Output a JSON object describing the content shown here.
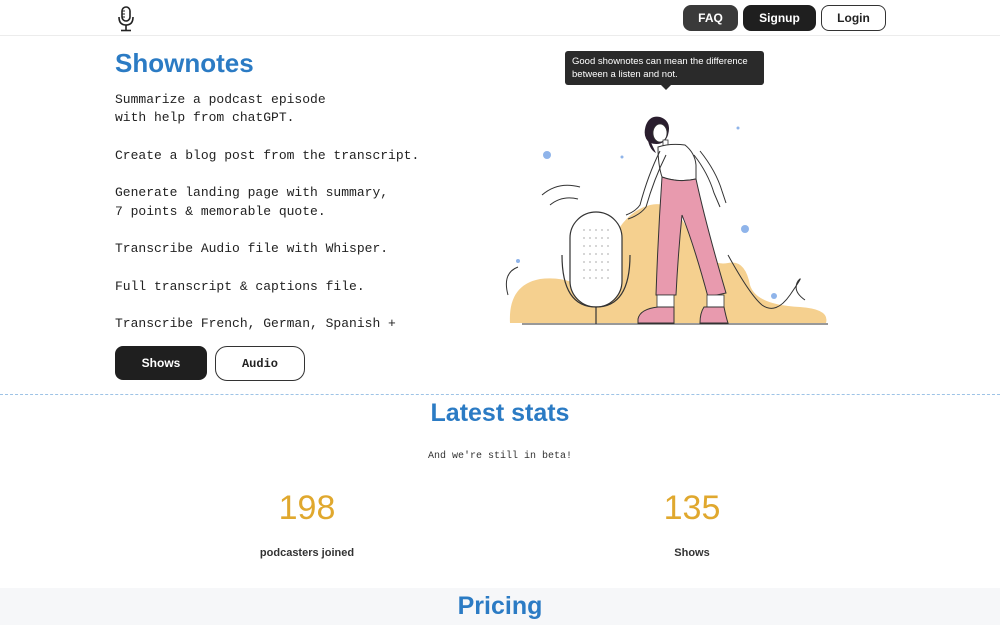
{
  "nav": {
    "logo_icon": "microphone-icon",
    "faq_label": "FAQ",
    "signup_label": "Signup",
    "login_label": "Login"
  },
  "hero": {
    "title": "Shownotes",
    "features": [
      "Summarize a podcast episode",
      "with help from chatGPT.",
      "Create a blog post from the transcript.",
      "Generate landing page with summary,",
      "7 points & memorable quote.",
      "Transcribe Audio file with Whisper.",
      "Full transcript & captions file.",
      "Transcribe French, German, Spanish +"
    ],
    "shows_label": "Shows",
    "audio_label": "Audio",
    "tooltip_line1": "Good shownotes can mean the difference",
    "tooltip_line2": "between a listen and not."
  },
  "stats": {
    "title": "Latest stats",
    "subtitle": "And we're still in beta!",
    "items": [
      {
        "value": "198",
        "label": "podcasters joined"
      },
      {
        "value": "135",
        "label": "Shows"
      }
    ]
  },
  "pricing": {
    "title": "Pricing"
  },
  "colors": {
    "accent_blue": "#2b7bc4",
    "stat_gold": "#e0a82e",
    "dark_button": "#1f1f1f",
    "illustration_sand": "#f5d08f",
    "illustration_pink": "#e89aae"
  }
}
